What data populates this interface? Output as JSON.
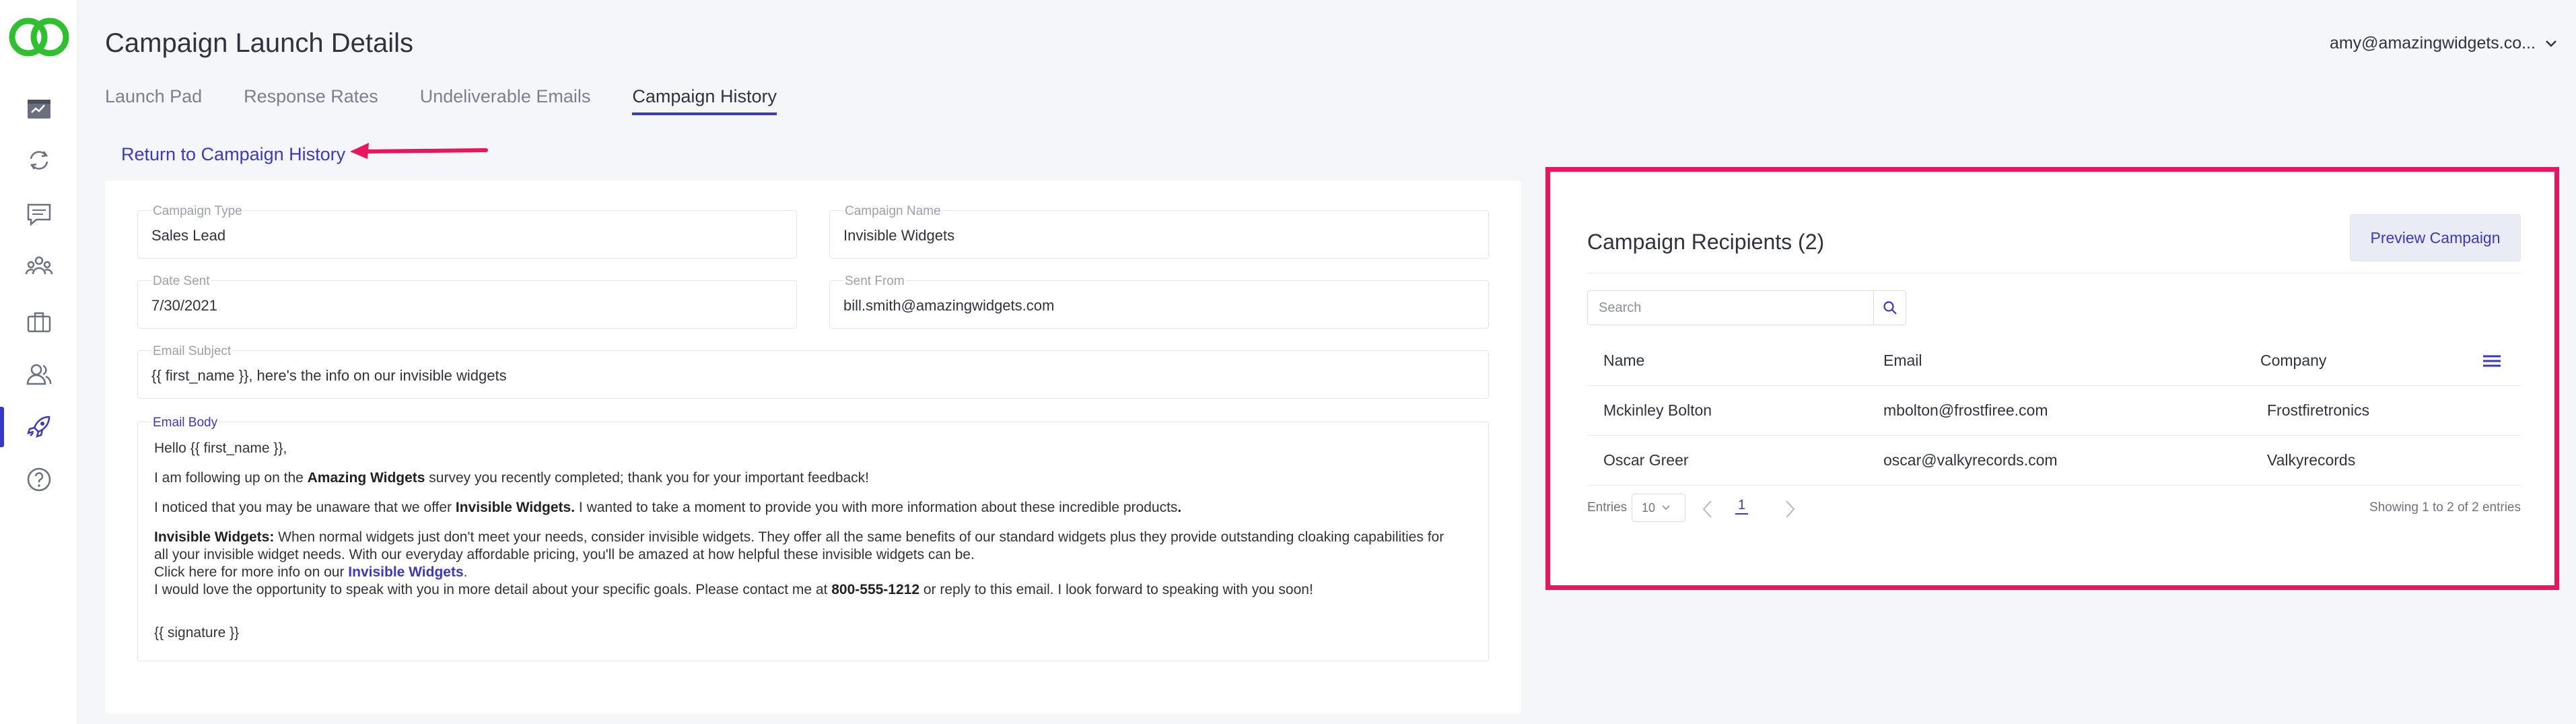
{
  "header": {
    "title": "Campaign Launch Details",
    "user_email": "amy@amazingwidgets.co..."
  },
  "tabs": [
    {
      "label": "Launch Pad"
    },
    {
      "label": "Response Rates"
    },
    {
      "label": "Undeliverable Emails"
    },
    {
      "label": "Campaign History"
    }
  ],
  "return_link": "Return to Campaign History",
  "form": {
    "campaign_type": {
      "label": "Campaign Type",
      "value": "Sales Lead"
    },
    "campaign_name": {
      "label": "Campaign Name",
      "value": "Invisible Widgets"
    },
    "date_sent": {
      "label": "Date Sent",
      "value": "7/30/2021"
    },
    "sent_from": {
      "label": "Sent From",
      "value": "bill.smith@amazingwidgets.com"
    },
    "email_subject": {
      "label": "Email Subject",
      "value": "{{ first_name }}, here's the info on our invisible widgets"
    },
    "email_body": {
      "label": "Email Body",
      "greeting": "Hello {{ first_name }},",
      "p1_pre": "I am following up on the ",
      "p1_bold": "Amazing Widgets",
      "p1_post": " survey you recently completed; thank you for your important feedback!",
      "p2_pre": "I noticed that you may be unaware that we offer ",
      "p2_bold": "Invisible Widgets.",
      "p2_post": " I wanted to take a moment to provide you with more information about these incredible products",
      "p2_bold_end": ".",
      "p3_bold": "Invisible Widgets:",
      "p3_text": " When normal widgets just don't meet your needs, consider invisible widgets.  They offer all the same benefits of our standard widgets plus they provide outstanding cloaking capabilities for all your invisible widget needs.  With our everyday affordable pricing, you'll be amazed at how helpful these invisible widgets can be.",
      "p4_pre": "Click here for more info on our ",
      "p4_link": "Invisible Widgets",
      "p4_post": ".",
      "p5_pre": "I would love the opportunity to speak with you in more detail about your specific goals. Please contact me at ",
      "p5_bold": "800-555-1212",
      "p5_post": " or reply to this email. I look forward to speaking with you soon!",
      "signature": "{{ signature }}"
    }
  },
  "recipients": {
    "title": "Campaign Recipients (2)",
    "preview_button": "Preview Campaign",
    "search_placeholder": "Search",
    "columns": {
      "name": "Name",
      "email": "Email",
      "company": "Company"
    },
    "rows": [
      {
        "name": "Mckinley Bolton",
        "email": "mbolton@frostfiree.com",
        "company": "Frostfiretronics"
      },
      {
        "name": "Oscar Greer",
        "email": "oscar@valkyrecords.com",
        "company": "Valkyrecords"
      }
    ],
    "entries_label": "Entries",
    "entries_value": "10",
    "current_page": "1",
    "showing": "Showing 1 to 2 of 2 entries"
  },
  "colors": {
    "accent": "#3b37c8",
    "highlight": "#e8175d",
    "logo": "#2fc02f"
  }
}
